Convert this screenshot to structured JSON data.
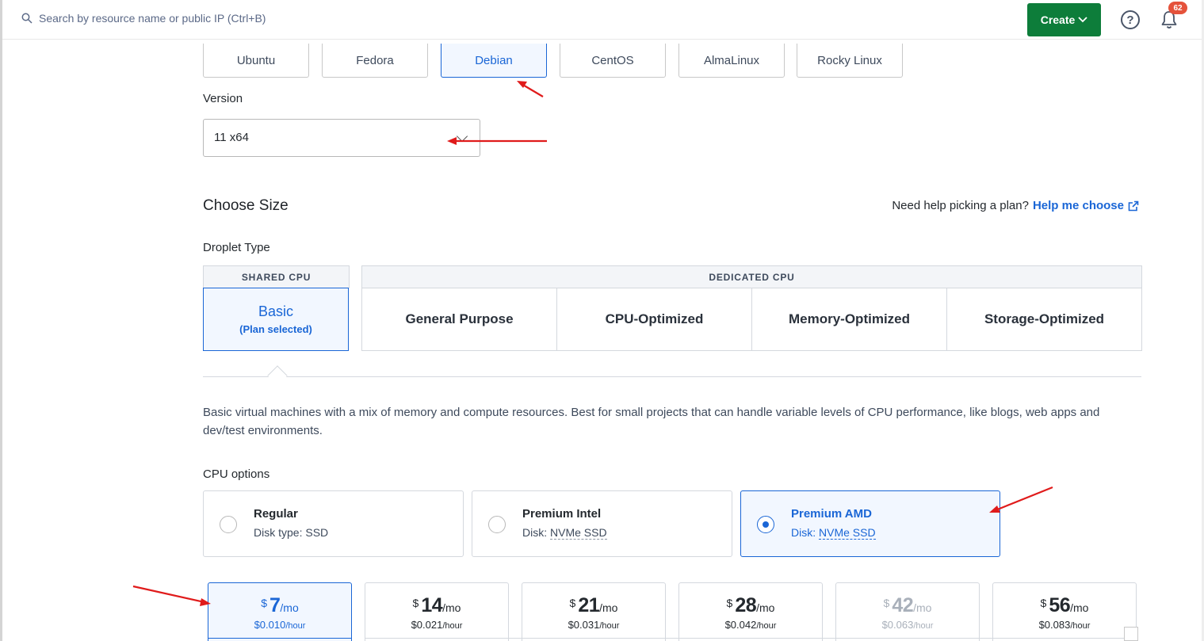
{
  "header": {
    "search_placeholder": "Search by resource name or public IP (Ctrl+B)",
    "create_label": "Create",
    "help_glyph": "?",
    "notifications_count": "62"
  },
  "distributions": [
    {
      "label": "Ubuntu",
      "selected": false
    },
    {
      "label": "Fedora",
      "selected": false
    },
    {
      "label": "Debian",
      "selected": true
    },
    {
      "label": "CentOS",
      "selected": false
    },
    {
      "label": "AlmaLinux",
      "selected": false
    },
    {
      "label": "Rocky Linux",
      "selected": false
    }
  ],
  "version": {
    "label": "Version",
    "value": "11 x64"
  },
  "choose_size": {
    "title": "Choose Size",
    "help_prefix": "Need help picking a plan?",
    "help_link": "Help me choose"
  },
  "droplet_type": {
    "label": "Droplet Type",
    "shared_header": "SHARED CPU",
    "dedicated_header": "DEDICATED CPU",
    "basic": {
      "label": "Basic",
      "sub": "(Plan selected)"
    },
    "dedicated_options": [
      "General Purpose",
      "CPU-Optimized",
      "Memory-Optimized",
      "Storage-Optimized"
    ]
  },
  "description": "Basic virtual machines with a mix of memory and compute resources. Best for small projects that can handle variable levels of CPU performance, like blogs, web apps and dev/test environments.",
  "cpu_options": {
    "label": "CPU options",
    "items": [
      {
        "title": "Regular",
        "sub_prefix": "Disk type: ",
        "sub_value": "SSD",
        "selected": false
      },
      {
        "title": "Premium Intel",
        "sub_prefix": "Disk: ",
        "sub_value": "NVMe SSD",
        "selected": false
      },
      {
        "title": "Premium AMD",
        "sub_prefix": "Disk: ",
        "sub_value": "NVMe SSD",
        "selected": true
      }
    ]
  },
  "prices": [
    {
      "currency": "$",
      "amount": "7",
      "per": "/mo",
      "hourly": "$0.010",
      "hourly_unit": "/hour",
      "selected": true,
      "disabled": false
    },
    {
      "currency": "$",
      "amount": "14",
      "per": "/mo",
      "hourly": "$0.021",
      "hourly_unit": "/hour",
      "selected": false,
      "disabled": false
    },
    {
      "currency": "$",
      "amount": "21",
      "per": "/mo",
      "hourly": "$0.031",
      "hourly_unit": "/hour",
      "selected": false,
      "disabled": false
    },
    {
      "currency": "$",
      "amount": "28",
      "per": "/mo",
      "hourly": "$0.042",
      "hourly_unit": "/hour",
      "selected": false,
      "disabled": false
    },
    {
      "currency": "$",
      "amount": "42",
      "per": "/mo",
      "hourly": "$0.063",
      "hourly_unit": "/hour",
      "selected": false,
      "disabled": true
    },
    {
      "currency": "$",
      "amount": "56",
      "per": "/mo",
      "hourly": "$0.083",
      "hourly_unit": "/hour",
      "selected": false,
      "disabled": false
    }
  ],
  "colors": {
    "accent": "#1a66d6",
    "create_button": "#0d7d3a",
    "annotation_arrow": "#e01b1b",
    "badge": "#e5523b"
  }
}
